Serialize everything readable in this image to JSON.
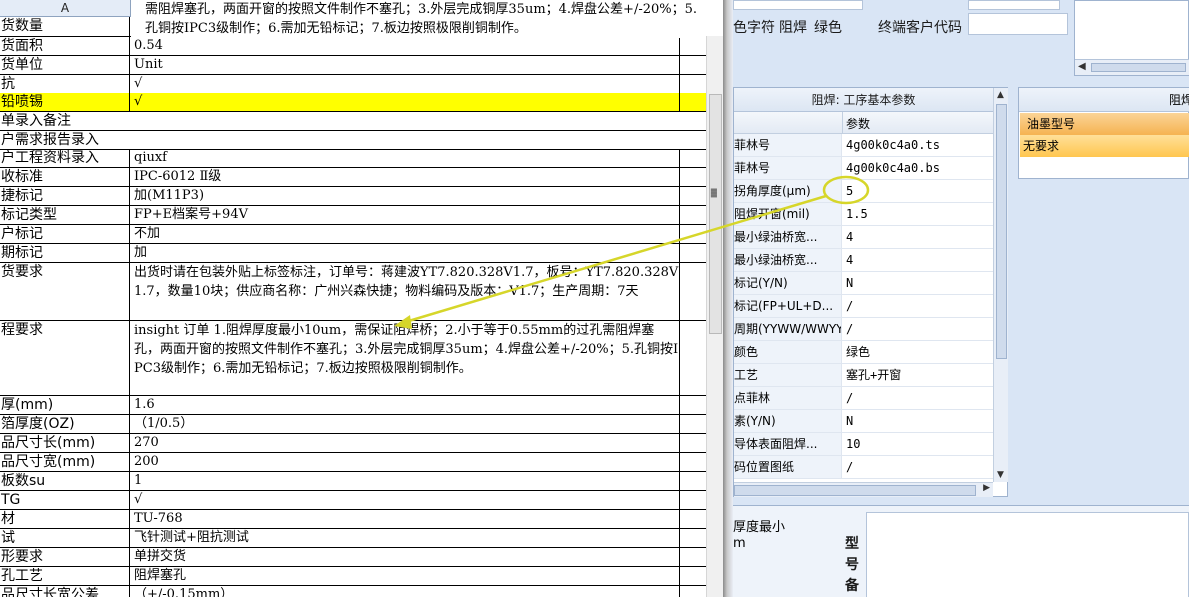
{
  "sheet": {
    "column_header": "A",
    "top_note": "需阻焊塞孔，两面开窗的按照文件制作不塞孔；3.外层完成铜厚35um；4.焊盘公差+/-20%；5.孔铜按IPC3级制作；6.需加无铅标记；7.板边按照极限削铜制作。",
    "rows": [
      {
        "k": "货数量",
        "v": ""
      },
      {
        "k": "货面积",
        "v": "0.54"
      },
      {
        "k": "货单位",
        "v": "Unit"
      },
      {
        "k": "抗",
        "v": "√"
      },
      {
        "k": "铅喷锡",
        "v": "√"
      },
      {
        "k": "单录入备注",
        "v": ""
      },
      {
        "k": "户需求报告录入",
        "v": ""
      },
      {
        "k": "户工程资料录入",
        "v": "qiuxf"
      },
      {
        "k": "收标准",
        "v": "IPC-6012 Ⅱ级"
      },
      {
        "k": "捷标记",
        "v": "加(M11P3)"
      },
      {
        "k": "标记类型",
        "v": "FP+E档案号+94V"
      },
      {
        "k": "户标记",
        "v": "不加"
      },
      {
        "k": "期标记",
        "v": "加"
      },
      {
        "k": "货要求",
        "v": "出货时请在包装外贴上标签标注，订单号：蒋建波YT7.820.328V1.7，板号：YT7.820.328V1.7，数量10块；供应商名称：广州兴森快捷；物料编码及版本：V1.7；生产周期：7天"
      },
      {
        "k": "程要求",
        "v": "insight 订单 1.阻焊厚度最小10um，需保证阻焊桥；2.小于等于0.55mm的过孔需阻焊塞孔，两面开窗的按照文件制作不塞孔；3.外层完成铜厚35um；4.焊盘公差+/-20%；5.孔铜按IPC3级制作；6.需加无铅标记；7.板边按照极限削铜制作。"
      },
      {
        "k": "厚(mm)",
        "v": "1.6"
      },
      {
        "k": "箔厚度(OZ)",
        "v": "（1/0.5）"
      },
      {
        "k": "品尺寸长(mm)",
        "v": "270"
      },
      {
        "k": "品尺寸宽(mm)",
        "v": "200"
      },
      {
        "k": "板数su",
        "v": "1"
      },
      {
        "k": "TG",
        "v": "√"
      },
      {
        "k": "材",
        "v": "TU-768"
      },
      {
        "k": "试",
        "v": "飞针测试+阻抗测试"
      },
      {
        "k": "形要求",
        "v": "单拼交货"
      },
      {
        "k": "孔工艺",
        "v": "阻焊塞孔"
      },
      {
        "k": "品尺寸长宽公差",
        "v": "（+/-0.15mm）"
      }
    ]
  },
  "app": {
    "top_labels": [
      "色字符",
      "阻焊",
      "绿色",
      "终端客户代码"
    ],
    "grid_title": "阻焊: 工序基本参数",
    "grid_header": "参数",
    "grid_rows": [
      {
        "label": "菲林号",
        "value": "4g00k0c4a0.ts"
      },
      {
        "label": "菲林号",
        "value": "4g00k0c4a0.bs"
      },
      {
        "label": "拐角厚度(μm)",
        "value": "5"
      },
      {
        "label": "阻焊开窗(mil)",
        "value": "1.5"
      },
      {
        "label": "最小绿油桥宽...",
        "value": "4"
      },
      {
        "label": "最小绿油桥宽...",
        "value": "4"
      },
      {
        "label": "标记(Y/N)",
        "value": "N"
      },
      {
        "label": "标记(FP+UL+D...",
        "value": "/"
      },
      {
        "label": "周期(YYWW/WWYY)",
        "value": "/"
      },
      {
        "label": "颜色",
        "value": "绿色"
      },
      {
        "label": "工艺",
        "value": "塞孔+开窗"
      },
      {
        "label": "点菲林",
        "value": "/"
      },
      {
        "label": "素(Y/N)",
        "value": "N"
      },
      {
        "label": "导体表面阻焊...",
        "value": "10"
      },
      {
        "label": "码位置图纸",
        "value": "/"
      }
    ],
    "ink_panel": {
      "title": "阻焊",
      "row1": "油墨型号",
      "row2": "无要求"
    },
    "bottom": {
      "label1": "厚度最小",
      "label2": "m",
      "vertical": [
        "型",
        "号",
        "备"
      ]
    }
  },
  "colors": {
    "highlight": "#ffff00",
    "annotation": "#d6d62a",
    "panel_bg": "#d9e5f5",
    "selected_row": "#f5b351"
  }
}
